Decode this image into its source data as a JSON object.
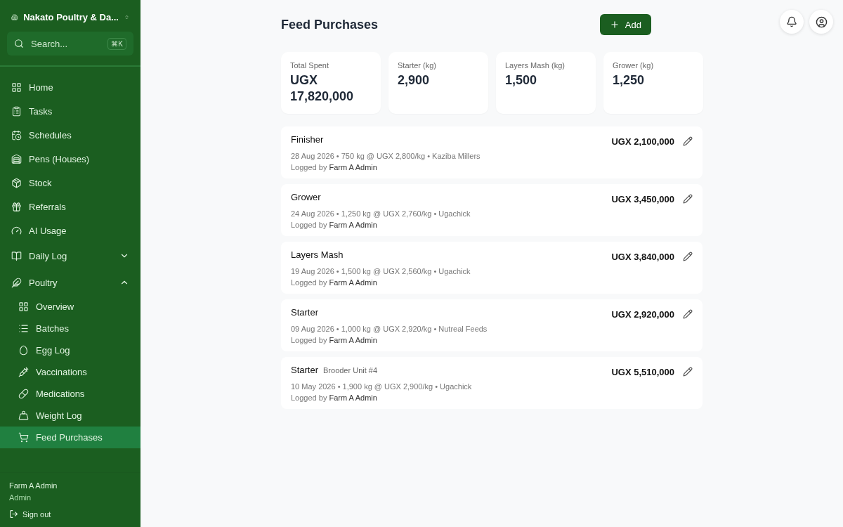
{
  "sidebar": {
    "org": "Nakato Poultry & Da...",
    "search": {
      "placeholder": "Search...",
      "shortcut": "⌘K"
    },
    "items": [
      {
        "label": "Home",
        "selected": false
      },
      {
        "label": "Tasks",
        "selected": false
      },
      {
        "label": "Schedules",
        "selected": false
      },
      {
        "label": "Pens (Houses)",
        "selected": false
      },
      {
        "label": "Stock",
        "selected": false
      },
      {
        "label": "Referrals",
        "selected": false
      },
      {
        "label": "AI Usage",
        "selected": false
      },
      {
        "label": "Daily Log",
        "selected": false,
        "expanded": false
      },
      {
        "label": "Poultry",
        "selected": false,
        "expanded": true,
        "children": [
          {
            "label": "Overview",
            "selected": false
          },
          {
            "label": "Batches",
            "selected": false
          },
          {
            "label": "Egg Log",
            "selected": false
          },
          {
            "label": "Vaccinations",
            "selected": false
          },
          {
            "label": "Medications",
            "selected": false
          },
          {
            "label": "Weight Log",
            "selected": false
          },
          {
            "label": "Feed Purchases",
            "selected": true
          }
        ]
      }
    ],
    "user": {
      "name": "Farm A Admin",
      "role": "Admin"
    },
    "sign_out": "Sign out"
  },
  "header": {
    "title": "Feed Purchases",
    "add_button": "Add"
  },
  "stats": [
    {
      "label": "Total Spent",
      "value": "UGX 17,820,000"
    },
    {
      "label": "Starter (kg)",
      "value": "2,900"
    },
    {
      "label": "Layers Mash (kg)",
      "value": "1,500"
    },
    {
      "label": "Grower (kg)",
      "value": "1,250"
    }
  ],
  "purchases": [
    {
      "feed": "Finisher",
      "details": "28 Aug 2026 • 750 kg @ UGX 2,800/kg • Kaziba Millers",
      "logged_by_label": "Logged by",
      "logged_by": "Farm A Admin",
      "total": "UGX 2,100,000"
    },
    {
      "feed": "Grower",
      "details": "24 Aug 2026 • 1,250 kg @ UGX 2,760/kg • Ugachick",
      "logged_by_label": "Logged by",
      "logged_by": "Farm A Admin",
      "total": "UGX 3,450,000"
    },
    {
      "feed": "Layers Mash",
      "details": "19 Aug 2026 • 1,500 kg @ UGX 2,560/kg • Ugachick",
      "logged_by_label": "Logged by",
      "logged_by": "Farm A Admin",
      "total": "UGX 3,840,000"
    },
    {
      "feed": "Starter",
      "details": "09 Aug 2026 • 1,000 kg @ UGX 2,920/kg • Nutreal Feeds",
      "logged_by_label": "Logged by",
      "logged_by": "Farm A Admin",
      "total": "UGX 2,920,000"
    },
    {
      "feed": "Starter",
      "batch": "Brooder Unit #4",
      "details": "10 May 2026 • 1,900 kg @ UGX 2,900/kg • Ugachick",
      "logged_by_label": "Logged by",
      "logged_by": "Farm A Admin",
      "total": "UGX 5,510,000"
    }
  ]
}
